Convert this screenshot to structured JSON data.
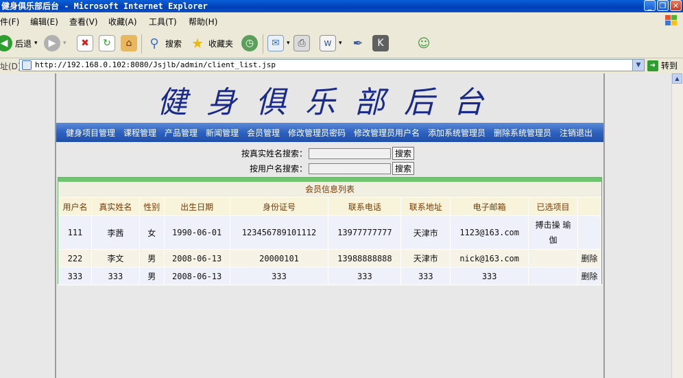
{
  "window": {
    "title": "健身俱乐部后台 - Microsoft Internet Explorer"
  },
  "menu": [
    "件(F)",
    "编辑(E)",
    "查看(V)",
    "收藏(A)",
    "工具(T)",
    "帮助(H)"
  ],
  "toolbar": {
    "back": "后退",
    "search": "搜索",
    "favorites": "收藏夹"
  },
  "address": {
    "label": "址(D)",
    "url": "http://192.168.0.102:8080/Jsjlb/admin/client_list.jsp",
    "go": "转到"
  },
  "banner": {
    "title": "健身俱乐部后台"
  },
  "nav": [
    "健身项目管理",
    "课程管理",
    "产品管理",
    "新闻管理",
    "会员管理",
    "修改管理员密码",
    "修改管理员用户名",
    "添加系统管理员",
    "删除系统管理员",
    "注销退出"
  ],
  "search": {
    "by_name_label": "按真实姓名搜索：",
    "by_user_label": "按用户名搜索：",
    "button": "搜索"
  },
  "table": {
    "title": "会员信息列表",
    "headers": [
      "用户名",
      "真实姓名",
      "性别",
      "出生日期",
      "身份证号",
      "联系电话",
      "联系地址",
      "电子邮箱",
      "已选项目",
      ""
    ],
    "rows": [
      [
        "111",
        "李茜",
        "女",
        "1990-06-01",
        "123456789101112",
        "13977777777",
        "天津市",
        "1123@163.com",
        "搏击操 瑜伽",
        ""
      ],
      [
        "222",
        "李文",
        "男",
        "2008-06-13",
        "20000101",
        "13988888888",
        "天津市",
        "nick@163.com",
        "",
        "删除"
      ],
      [
        "333",
        "333",
        "男",
        "2008-06-13",
        "333",
        "333",
        "333",
        "333",
        "",
        "删除"
      ]
    ]
  }
}
